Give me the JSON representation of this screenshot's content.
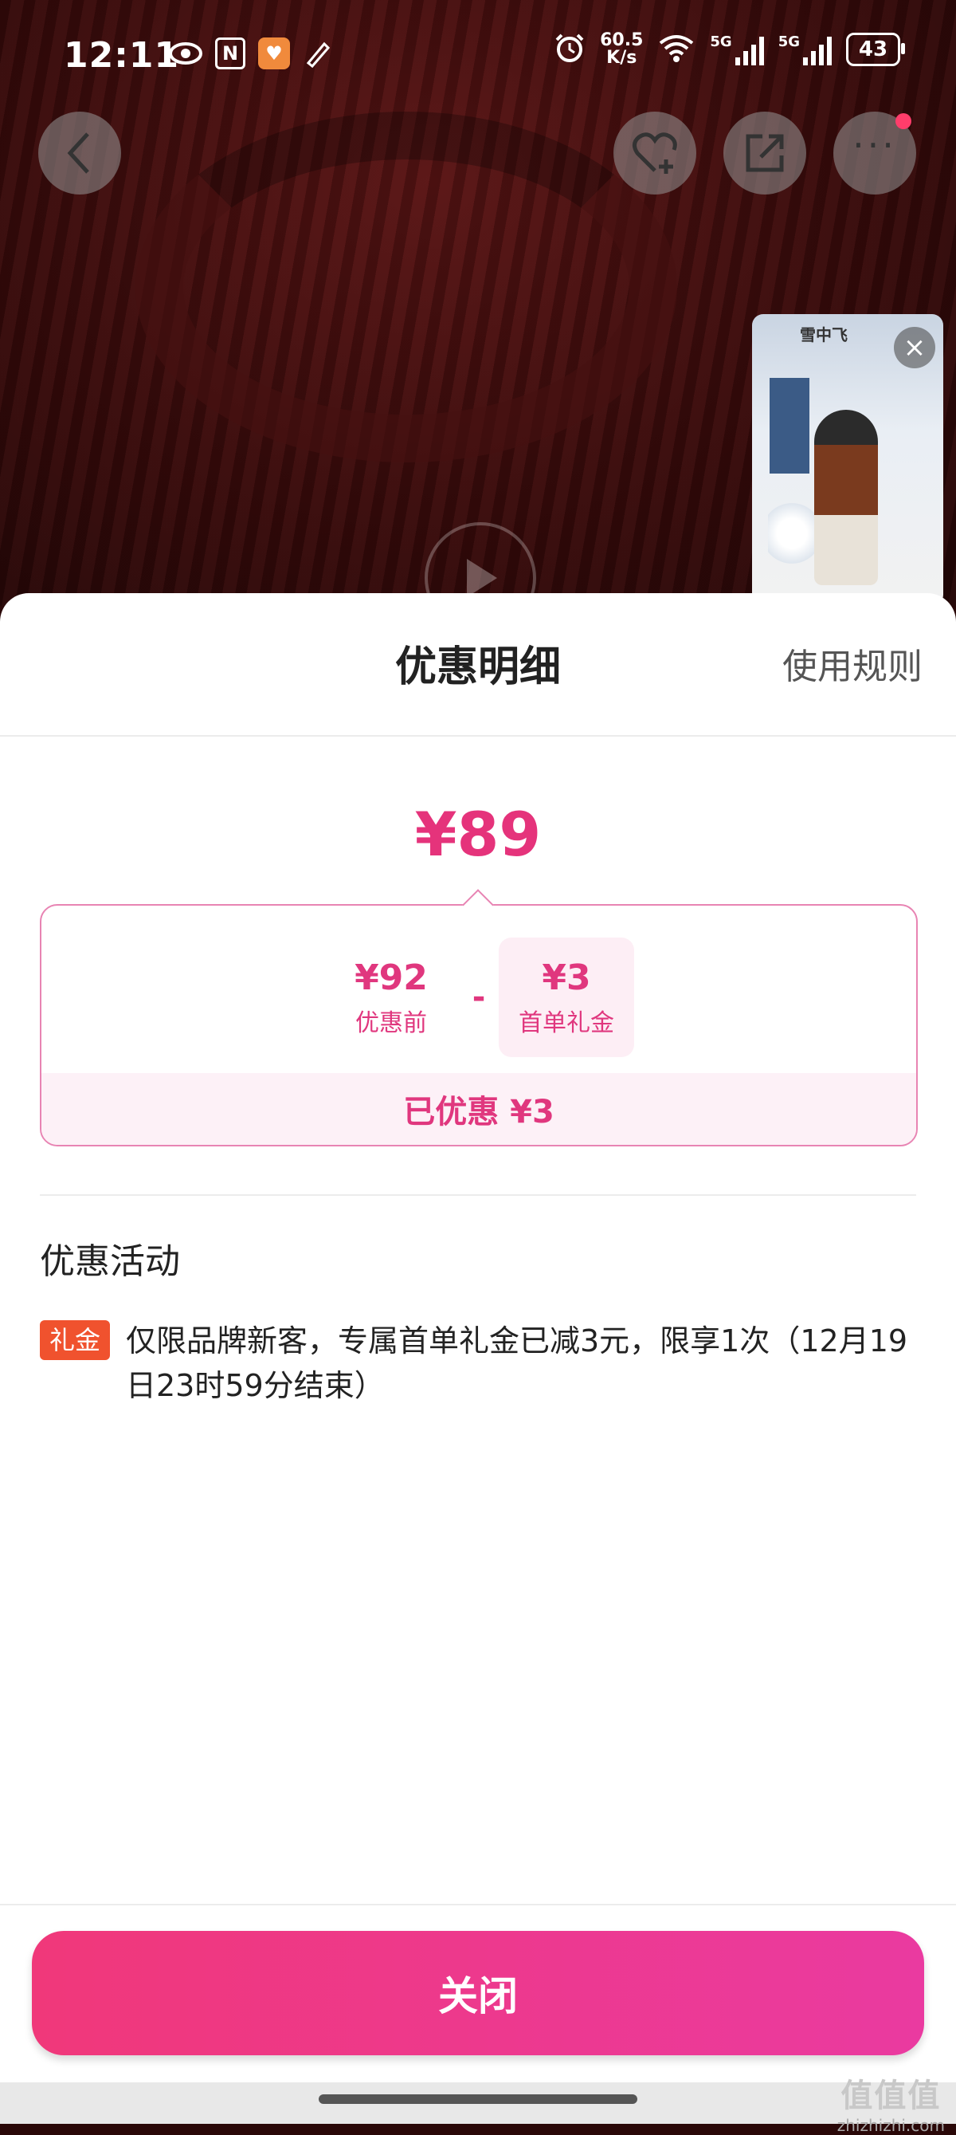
{
  "status_bar": {
    "time": "12:11",
    "net_speed_value": "60.5",
    "net_speed_unit": "K/s",
    "network_1": "5G",
    "network_2": "5G",
    "battery": "43"
  },
  "product_bg": {
    "pip_brand": "雪中飞"
  },
  "sheet": {
    "title": "优惠明细",
    "rules_link": "使用规则",
    "final_price": "¥89",
    "breakdown": {
      "original_value": "¥92",
      "original_label": "优惠前",
      "minus": "-",
      "discount_value": "¥3",
      "discount_label": "首单礼金"
    },
    "saved_text": "已优惠 ¥3",
    "section_title": "优惠活动",
    "promo": {
      "tag": "礼金",
      "text": "仅限品牌新客，专属首单礼金已减3元，限享1次（12月19日23时59分结束）"
    },
    "close_button": "关闭"
  },
  "watermark": {
    "logo": "值值值",
    "site": "zhizhizhi.com"
  },
  "colors": {
    "accent": "#e5337b",
    "tag": "#f0522e",
    "button_start": "#f0387a",
    "button_end": "#ea3aa0"
  }
}
